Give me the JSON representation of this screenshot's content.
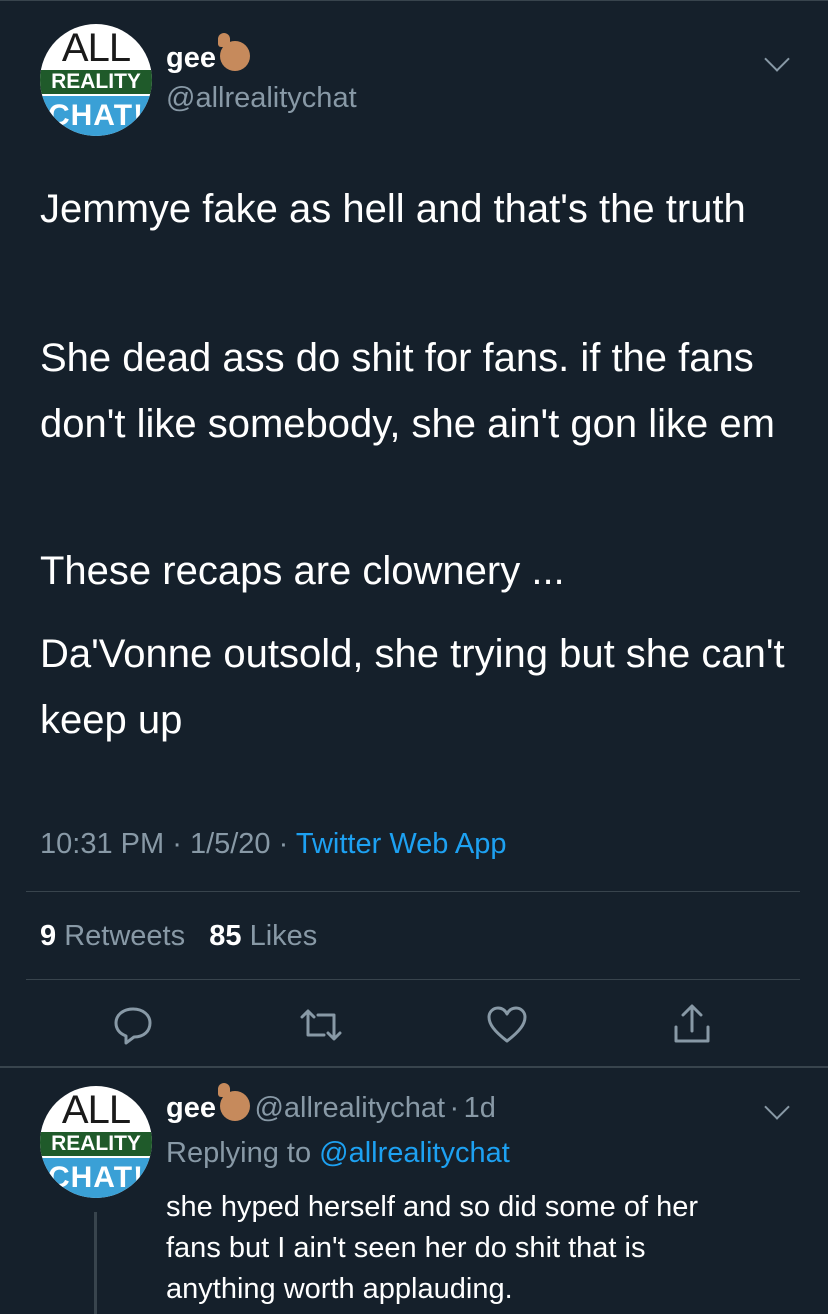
{
  "tweet": {
    "display_name": "gee",
    "handle": "@allrealitychat",
    "avatar_text": {
      "top": "ALL",
      "middle": "REALITY",
      "bottom": "CHAT!"
    },
    "paragraphs": [
      "Jemmye fake as hell and that's the truth",
      "She dead ass do shit for fans. if the fans don't like somebody, she ain't gon like em",
      "These recaps are clownery ...",
      "Da'Vonne outsold, she trying but she can't keep up"
    ],
    "time": "10:31 PM",
    "date": "1/5/20",
    "separator": "·",
    "source": "Twitter Web App",
    "retweets_count": "9",
    "retweets_label": "Retweets",
    "likes_count": "85",
    "likes_label": "Likes",
    "actions": [
      "reply-icon",
      "retweet-icon",
      "like-icon",
      "share-icon"
    ]
  },
  "reply": {
    "display_name": "gee",
    "handle": "@allrealitychat",
    "separator": "·",
    "age": "1d",
    "replying_prefix": "Replying to",
    "replying_to": "@allrealitychat",
    "text_lines": [
      "she hyped herself and so did some of her",
      "fans but I ain't seen her do shit that is",
      "anything worth applauding."
    ]
  },
  "colors": {
    "background": "#15202b",
    "secondary_text": "#8899a6",
    "accent": "#1da1f2",
    "divider": "#38444d"
  }
}
